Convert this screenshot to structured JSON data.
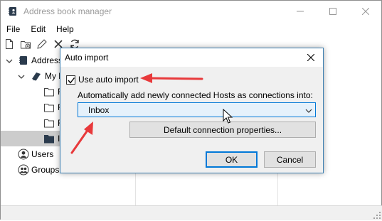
{
  "app": {
    "title": "Address book manager",
    "window_controls": [
      "minimize-icon",
      "maximize-icon",
      "close-icon"
    ]
  },
  "menu": {
    "items": [
      "File",
      "Edit",
      "Help"
    ]
  },
  "toolbar": {
    "icons": [
      "new-file-icon",
      "new-folder-icon",
      "edit-pencil-icon",
      "delete-x-icon",
      "refresh-icon"
    ]
  },
  "tree": {
    "items": [
      {
        "label": "Address",
        "icon": "address-book-icon",
        "level": 0,
        "expanded": true
      },
      {
        "label": "My b",
        "icon": "book-icon",
        "level": 1,
        "expanded": true
      },
      {
        "label": "F",
        "icon": "folder-icon",
        "level": 2
      },
      {
        "label": "F",
        "icon": "folder-icon",
        "level": 2
      },
      {
        "label": "F",
        "icon": "folder-icon",
        "level": 2
      },
      {
        "label": "I",
        "icon": "folder-icon",
        "level": 2,
        "selected": true
      },
      {
        "label": "Users",
        "icon": "user-icon",
        "level": 0
      },
      {
        "label": "Groups",
        "icon": "group-icon",
        "level": 0
      }
    ]
  },
  "dialog": {
    "title": "Auto import",
    "checkbox_label": "Use auto import",
    "checkbox_checked": true,
    "description": "Automatically add newly connected Hosts as connections into:",
    "selected_target": "Inbox",
    "default_props_label": "Default connection properties...",
    "ok_label": "OK",
    "cancel_label": "Cancel"
  },
  "colors": {
    "annotation_arrow": "#e8393b",
    "dialog_border": "#3c7fb1",
    "select_bg": "#e5f1fb",
    "focus_blue": "#0078d7",
    "selected_row": "#cccccc"
  }
}
